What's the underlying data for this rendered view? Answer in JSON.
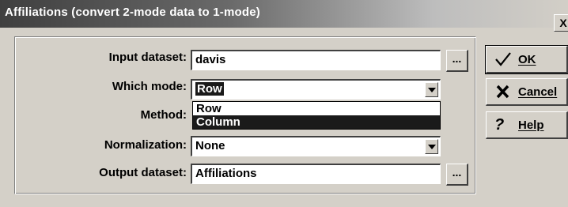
{
  "window": {
    "title": "Affiliations (convert 2-mode data to 1-mode)",
    "close_label": "X"
  },
  "form": {
    "input_dataset": {
      "label": "Input dataset:",
      "value": "davis",
      "browse_label": "..."
    },
    "which_mode": {
      "label": "Which mode:",
      "value": "Row",
      "options": [
        "Row",
        "Column"
      ],
      "highlighted_option": "Column"
    },
    "method": {
      "label": "Method:"
    },
    "normalization": {
      "label": "Normalization:",
      "value": "None"
    },
    "output_dataset": {
      "label": "Output dataset:",
      "value": "Affiliations",
      "browse_label": "..."
    }
  },
  "buttons": {
    "ok": {
      "label": "OK",
      "icon": "checkmark-icon"
    },
    "cancel": {
      "label": "Cancel",
      "icon": "x-icon"
    },
    "help": {
      "label": "Help",
      "icon": "question-icon"
    }
  }
}
